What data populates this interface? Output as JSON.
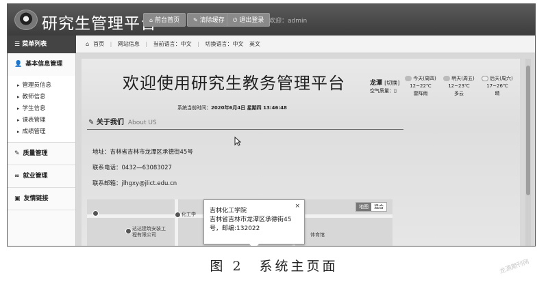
{
  "app": {
    "title": "研究生管理平台"
  },
  "header": {
    "buttons": [
      {
        "label": "前台首页",
        "icon": "home-icon"
      },
      {
        "label": "清除缓存",
        "icon": "wrench-icon"
      },
      {
        "label": "退出登录",
        "icon": "power-icon"
      }
    ],
    "welcome": "欢迎：admin"
  },
  "menu": {
    "header": "菜单列表"
  },
  "breadcrumb": {
    "home": "首页",
    "site_info": "网站信息",
    "current_lang": "当前语言：中文",
    "switch_lang_label": "切换语言：",
    "lang_zh": "中文",
    "lang_en": "英文"
  },
  "sidebar": {
    "sections": [
      {
        "label": "基本信息管理",
        "icon": "user-icon"
      },
      {
        "label": "质量管理",
        "icon": "edit-icon"
      },
      {
        "label": "就业管理",
        "icon": "link-icon"
      },
      {
        "label": "友情链接",
        "icon": "book-icon"
      }
    ],
    "items": [
      "管理员信息",
      "教师信息",
      "学生信息",
      "课表管理",
      "成绩管理"
    ]
  },
  "main": {
    "welcome_title": "欢迎使用研究生教务管理平台",
    "systime_label": "系统当前时间：",
    "systime_value": "2020年6月4日 星期四 13:46:48",
    "about_title": "关于我们",
    "about_en": "About US",
    "address": "地址：吉林省吉林市龙潭区承德街45号",
    "phone": "联系电话：0432—63083027",
    "email": "联系邮箱：jlhgxy@jlict.edu.cn"
  },
  "weather": {
    "city": "龙潭",
    "switch": "[切换]",
    "air_quality": "空气质量：",
    "days": [
      {
        "label": "今天(周四)",
        "temp": "12~22℃",
        "desc": "雷阵雨"
      },
      {
        "label": "明天(周五)",
        "temp": "12~23℃",
        "desc": "多云"
      },
      {
        "label": "后天(周六)",
        "temp": "17~26℃",
        "desc": "晴"
      }
    ]
  },
  "map": {
    "labels": [
      "化工学",
      "达达建筑安装工程有限公司",
      "体育馆"
    ],
    "mode_map": "地图",
    "mode_hybrid": "混合",
    "popup": {
      "title": "吉林化工学院",
      "address": "吉林省吉林市龙潭区承德街45号，邮编:132022",
      "close": "×"
    }
  },
  "caption": "图 2　系统主页面",
  "watermark": "龙源期刊网"
}
